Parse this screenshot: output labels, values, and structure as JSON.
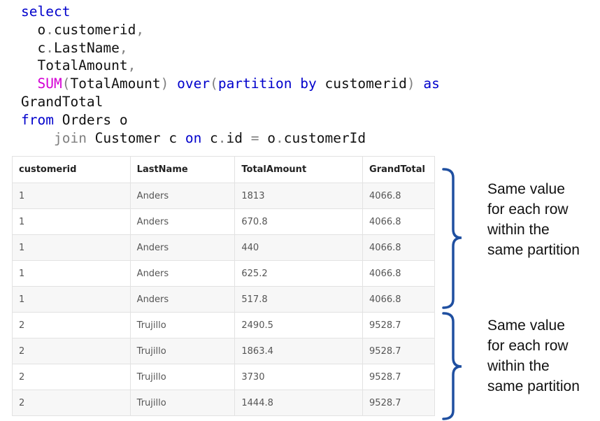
{
  "code": {
    "lines": [
      [
        {
          "t": "select",
          "c": "kw"
        }
      ],
      [
        {
          "t": "  o"
        },
        {
          "t": ".",
          "c": "op"
        },
        {
          "t": "customerid"
        },
        {
          "t": ",",
          "c": "op"
        }
      ],
      [
        {
          "t": "  c"
        },
        {
          "t": ".",
          "c": "op"
        },
        {
          "t": "LastName"
        },
        {
          "t": ",",
          "c": "op"
        }
      ],
      [
        {
          "t": "  TotalAmount"
        },
        {
          "t": ",",
          "c": "op"
        }
      ],
      [
        {
          "t": "  "
        },
        {
          "t": "SUM",
          "c": "fn"
        },
        {
          "t": "(",
          "c": "op"
        },
        {
          "t": "TotalAmount"
        },
        {
          "t": ")",
          "c": "op"
        },
        {
          "t": " "
        },
        {
          "t": "over",
          "c": "kw"
        },
        {
          "t": "(",
          "c": "op"
        },
        {
          "t": "partition",
          "c": "kw"
        },
        {
          "t": " "
        },
        {
          "t": "by",
          "c": "kw"
        },
        {
          "t": " customerid"
        },
        {
          "t": ")",
          "c": "op"
        },
        {
          "t": " "
        },
        {
          "t": "as",
          "c": "kw"
        }
      ],
      [
        {
          "t": "GrandTotal"
        }
      ],
      [
        {
          "t": "from",
          "c": "kw"
        },
        {
          "t": " Orders o"
        }
      ],
      [
        {
          "t": "    "
        },
        {
          "t": "join",
          "c": "op"
        },
        {
          "t": " Customer c "
        },
        {
          "t": "on",
          "c": "kw"
        },
        {
          "t": " c"
        },
        {
          "t": ".",
          "c": "op"
        },
        {
          "t": "id "
        },
        {
          "t": "=",
          "c": "op"
        },
        {
          "t": " o"
        },
        {
          "t": ".",
          "c": "op"
        },
        {
          "t": "customerId"
        }
      ]
    ]
  },
  "table": {
    "columns": [
      "customerid",
      "LastName",
      "TotalAmount",
      "GrandTotal"
    ],
    "rows": [
      [
        "1",
        "Anders",
        "1813",
        "4066.8"
      ],
      [
        "1",
        "Anders",
        "670.8",
        "4066.8"
      ],
      [
        "1",
        "Anders",
        "440",
        "4066.8"
      ],
      [
        "1",
        "Anders",
        "625.2",
        "4066.8"
      ],
      [
        "1",
        "Anders",
        "517.8",
        "4066.8"
      ],
      [
        "2",
        "Trujillo",
        "2490.5",
        "9528.7"
      ],
      [
        "2",
        "Trujillo",
        "1863.4",
        "9528.7"
      ],
      [
        "2",
        "Trujillo",
        "3730",
        "9528.7"
      ],
      [
        "2",
        "Trujillo",
        "1444.8",
        "9528.7"
      ]
    ]
  },
  "annotations": [
    {
      "lines": [
        "Same value",
        "for each row",
        "within the",
        "same partition"
      ]
    },
    {
      "lines": [
        "Same value",
        "for each row",
        "within the",
        "same partition"
      ]
    }
  ],
  "colors": {
    "keyword": "#0000cc",
    "function": "#d400d4",
    "brace": "#1f4fa0"
  }
}
